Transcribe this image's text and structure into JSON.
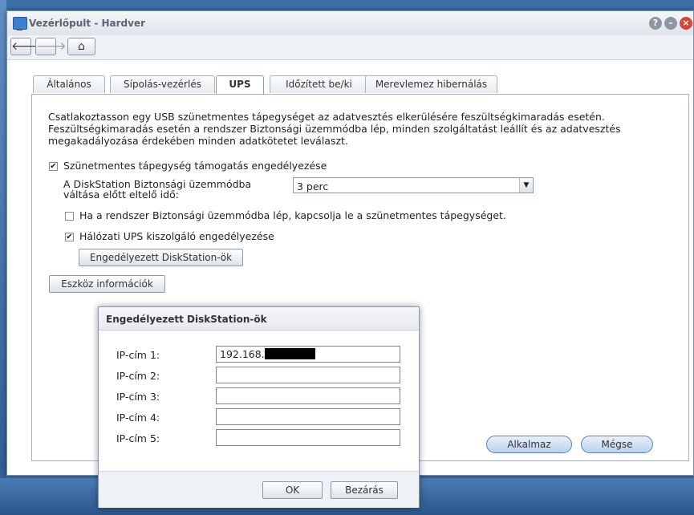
{
  "window": {
    "title": "Vezérlőpult - Hardver"
  },
  "title_controls": [
    "help-icon",
    "minimize-icon",
    "close-icon"
  ],
  "toolbar": {
    "back": "🡐",
    "forward": "🡒",
    "home": "⌂"
  },
  "tabs": [
    {
      "label": "Általános"
    },
    {
      "label": "Sípolás-vezérlés"
    },
    {
      "label": "UPS"
    },
    {
      "label": "Időzített be/ki"
    },
    {
      "label": "Merevlemez hibernálás"
    }
  ],
  "ups": {
    "description_1": "Csatlakoztasson egy USB szünetmentes tápegységet az adatvesztés elkerülésére feszültségkimaradás esetén.",
    "description_2": "Feszültségkimaradás esetén a rendszer Biztonsági üzemmódba lép, minden szolgáltatást leállít és az adatvesztés megakadályozása érdekében minden adatkötetet leválaszt.",
    "enable_ups_label": "Szünetmentes tápegység támogatás engedélyezése",
    "enable_ups_checked": true,
    "safe_mode_time_label_1": "A DiskStation Biztonsági üzemmódba",
    "safe_mode_time_label_2": "váltása előtt eltelő idő:",
    "safe_mode_time_value": "3 perc",
    "shutdown_ups_label": "Ha a rendszer Biztonsági üzemmódba lép, kapcsolja le a szünetmentes tápegységet.",
    "shutdown_ups_checked": false,
    "network_ups_label": "Hálózati UPS kiszolgáló engedélyezése",
    "network_ups_checked": true,
    "permitted_btn": "Engedélyezett DiskStation-ök",
    "device_info_btn": "Eszköz információk"
  },
  "footer": {
    "apply": "Alkalmaz",
    "cancel": "Mégse"
  },
  "dialog": {
    "title": "Engedélyezett DiskStation-ök",
    "rows": [
      {
        "label": "IP-cím 1:",
        "value": "192.168."
      },
      {
        "label": "IP-cím 2:",
        "value": ""
      },
      {
        "label": "IP-cím 3:",
        "value": ""
      },
      {
        "label": "IP-cím 4:",
        "value": ""
      },
      {
        "label": "IP-cím 5:",
        "value": ""
      }
    ],
    "ok": "OK",
    "close": "Bezárás"
  }
}
